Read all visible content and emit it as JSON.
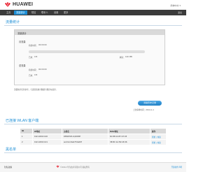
{
  "header": {
    "brand": "HUAWEI",
    "language": "简体中文 ▾",
    "logo_color": "#e60012"
  },
  "nav": {
    "items": [
      {
        "label": "主页",
        "active": false
      },
      {
        "label": "流量统计",
        "active": true
      },
      {
        "label": "短信",
        "active": false
      },
      {
        "label": "联系人",
        "active": false
      },
      {
        "label": "设置",
        "active": false
      },
      {
        "label": "更多",
        "active": false
      }
    ],
    "logout": "退出"
  },
  "stats": {
    "title": "流量统计",
    "panel_title": "流量统计",
    "monthly": {
      "label": "月流量",
      "duration_label": "持续时间：",
      "duration": "00:00:00",
      "used_label": "已用：",
      "used": "0 B",
      "remaining_label": "剩余：",
      "remaining": "100 MB",
      "progress": 0
    },
    "total": {
      "label": "总流量",
      "duration_label": "持续时间：",
      "duration": "00:00:00",
      "used_label": "已用：",
      "used": "0 B"
    },
    "note": "流量统计仅供参考，与运营商统计数据可能存在差异。",
    "clear_button": "清除历史记录",
    "updated_label": "上次清零时间：",
    "updated": "2014-1-1"
  },
  "wlan": {
    "title": "已连接 WLAN 客户端",
    "columns": [
      "ID",
      "IP地址",
      "主机名",
      "MAC地址",
      "操作"
    ],
    "rows": [
      {
        "id": "1",
        "ip": "192.168.8.100",
        "host": "DESKTOP-1Q2W3E",
        "mac": "6C:88:14:87:47:03",
        "op": "拒绝 | 恢复"
      },
      {
        "id": "2",
        "ip": "192.168.8.101",
        "host": "android-6a1f72e09f",
        "mac": "38:BC:1A:56:18:06",
        "op": "拒绝 | 恢复"
      }
    ]
  },
  "blocklist": {
    "title": "黑名单"
  },
  "footer": {
    "left": "隐私政策",
    "center": "©2014 华为技术有限公司 版权所有",
    "right": "开源软件声明"
  }
}
